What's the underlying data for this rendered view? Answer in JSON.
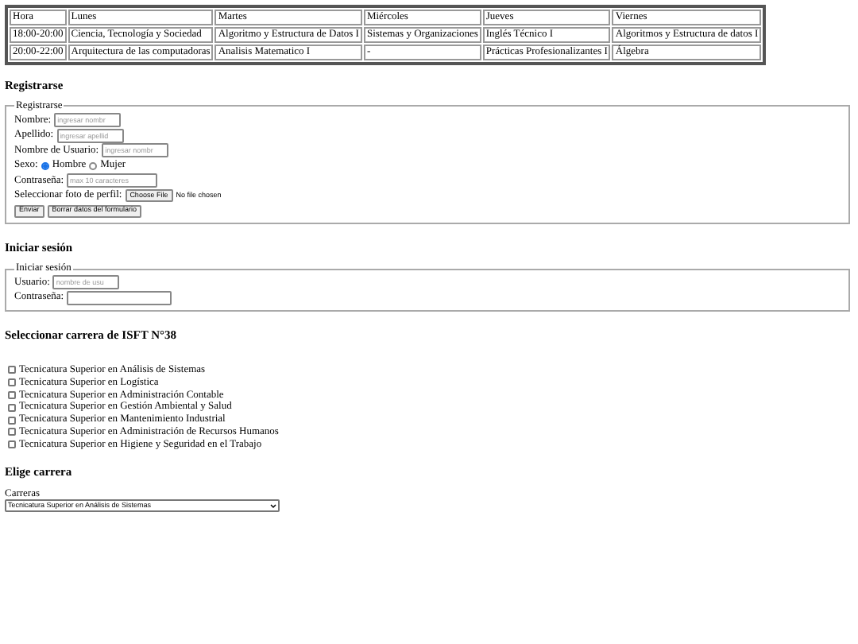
{
  "schedule": {
    "columns": [
      "Hora",
      "Lunes",
      "Martes",
      "Miércoles",
      "Jueves",
      "Viernes"
    ],
    "rows": [
      [
        "18:00-20:00",
        "Ciencia, Tecnología y Sociedad",
        "Algoritmo y Estructura de Datos I",
        "Sistemas y Organizaciones",
        "Inglés Técnico I",
        "Algoritmos y Estructura de datos I"
      ],
      [
        "20:00-22:00",
        "Arquitectura de las computadoras",
        "Analisis Matematico I",
        "-",
        "Prácticas Profesionalizantes I",
        "Álgebra"
      ]
    ]
  },
  "register": {
    "heading": "Registrarse",
    "legend": "Registrarse",
    "fields": [
      {
        "label": "Nombre:",
        "placeholder": "ingresar nombr",
        "kind": "short"
      },
      {
        "label": "Apellido:",
        "placeholder": "ingresar apellid",
        "kind": "short"
      },
      {
        "label": "Nombre de Usuario:",
        "placeholder": "ingresar nombr",
        "kind": "short"
      }
    ],
    "sex": {
      "label": "Sexo:",
      "options": [
        {
          "label": "Hombre",
          "selected": true
        },
        {
          "label": "Mujer",
          "selected": false
        }
      ]
    },
    "password": {
      "label": "Contraseña:",
      "placeholder": "max 10 caracteres"
    },
    "photo": {
      "label": "Seleccionar foto de perfil:",
      "button": "Choose File",
      "status": "No file chosen"
    },
    "buttons": [
      "Enviar",
      "Borrar datos del formulario"
    ]
  },
  "login": {
    "heading": "Iniciar sesión",
    "legend": "Iniciar sesión",
    "fields": [
      {
        "label": "Usuario:",
        "placeholder": "nombre de usu",
        "kind": "short"
      },
      {
        "label": "Contraseña:",
        "kind": "long"
      }
    ]
  },
  "careers": {
    "heading": "Seleccionar carrera de ISFT N°38",
    "items": [
      {
        "label": "Tecnicatura Superior en Análisis de Sistemas",
        "checked": false
      },
      {
        "label": "Tecnicatura Superior en Logística",
        "checked": false
      },
      {
        "label": "Tecnicatura Superior en Administración Contable",
        "checked": false
      },
      {
        "label": "Tecnicatura Superior en Gestión Ambiental y Salud",
        "checked": false
      },
      {
        "label": "Tecnicatura Superior en Mantenimiento Industrial",
        "checked": false
      },
      {
        "label": "Tecnicatura Superior en Administración de Recursos Humanos",
        "checked": false
      },
      {
        "label": "Tecnicatura Superior en Higiene y Seguridad en el Trabajo",
        "checked": false
      }
    ]
  },
  "choose": {
    "heading": "Elige carrera",
    "label": "Carreras",
    "value": "Tecnicatura Superior en Análisis de Sistemas"
  }
}
